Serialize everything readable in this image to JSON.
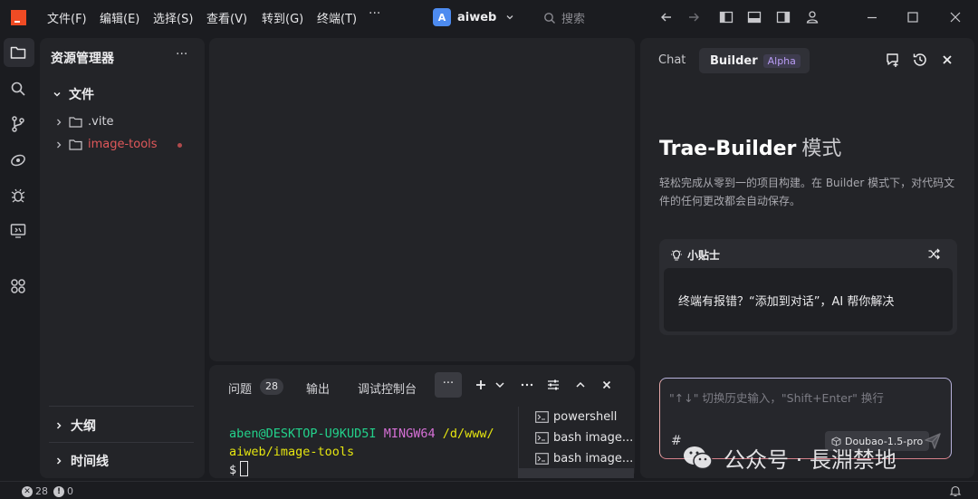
{
  "titlebar": {
    "menu": [
      "文件(F)",
      "编辑(E)",
      "选择(S)",
      "查看(V)",
      "转到(G)",
      "终端(T)"
    ],
    "more": "···",
    "workspace_avatar": "A",
    "workspace_name": "aiweb",
    "search_placeholder": "搜索"
  },
  "explorer": {
    "title": "资源管理器",
    "more": "···",
    "files_section": "文件",
    "folders": [
      ".vite",
      "image-tools"
    ],
    "outline_section": "大纲",
    "timeline_section": "时间线"
  },
  "terminal": {
    "tabs": {
      "problems": "问题",
      "problems_count": "28",
      "output": "输出",
      "debug_console": "调试控制台",
      "more": "···"
    },
    "lines": {
      "user_host": "aben@DESKTOP-U9KUD5I",
      "env": "MINGW64",
      "path_1": "/d/www/",
      "path_2": "aiweb/image-tools",
      "prompt": "$"
    },
    "sessions": [
      "powershell",
      "bash image...",
      "bash image..."
    ]
  },
  "builder": {
    "tab_chat": "Chat",
    "tab_builder": "Builder",
    "alpha_badge": "Alpha",
    "title_main": "Trae-Builder",
    "title_mode": "模式",
    "description": "轻松完成从零到一的项目构建。在 Builder 模式下，对代码文件的任何更改都会自动保存。",
    "tips_title": "小贴士",
    "tips_text": "终端有报错？“添加到对话”，AI 帮你解决",
    "input_placeholder": "\"↑↓\" 切换历史输入，\"Shift+Enter\" 换行",
    "hash": "#",
    "model": "Doubao-1.5-pro"
  },
  "watermark": "公众号 · 長淵禁地",
  "status": {
    "errors": "28",
    "warnings": "0"
  },
  "colors": {
    "logo": "#f04b24",
    "accent_avatar": "#4d8bf0",
    "error_folder": "#e0585a",
    "alpha_text": "#b99cf5",
    "term_green": "#23d18b",
    "term_magenta": "#d670d6",
    "term_yellow": "#e5e510"
  }
}
